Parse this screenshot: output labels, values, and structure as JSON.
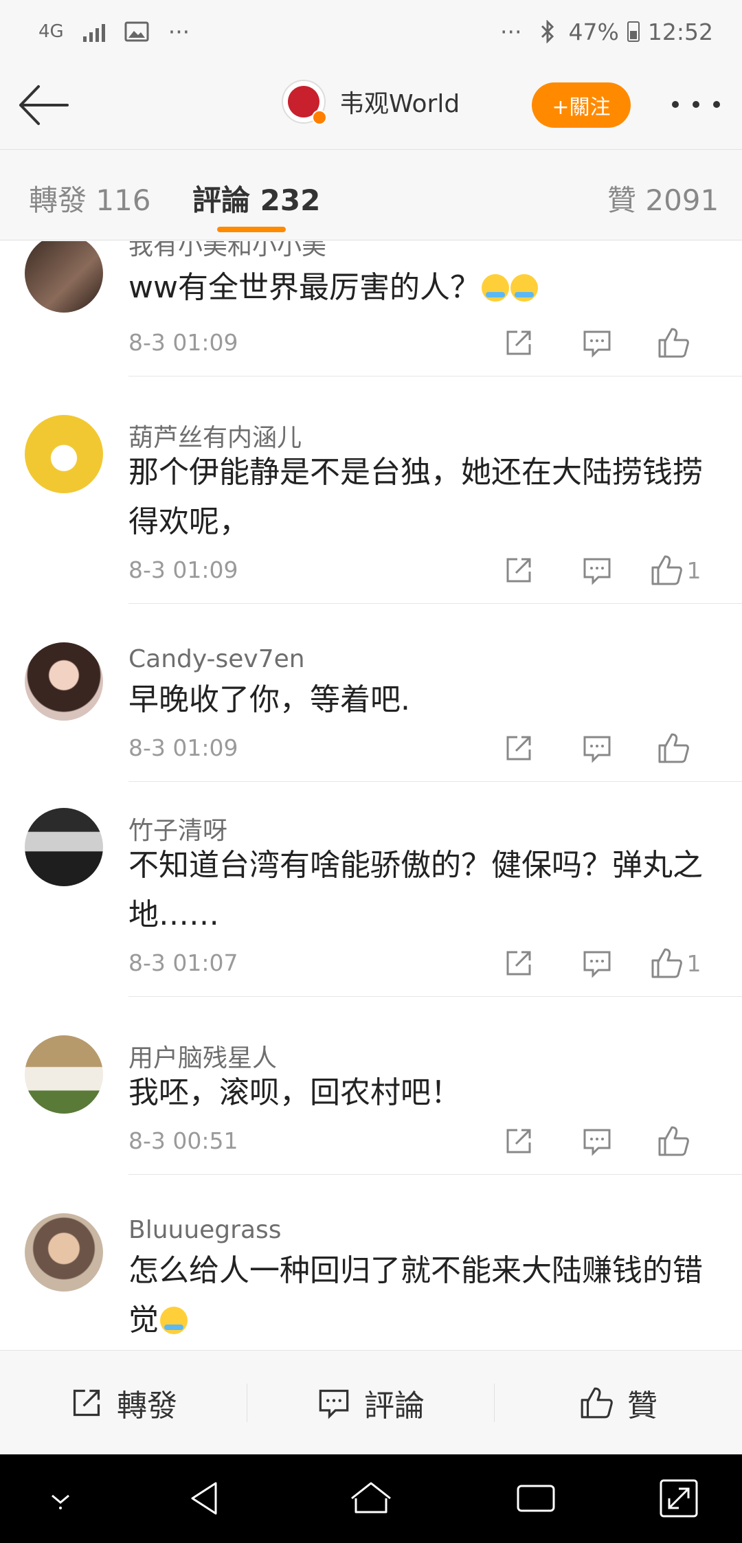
{
  "status_bar": {
    "network": "4G",
    "dots_left": "···",
    "dots_right": "···",
    "battery": "47%",
    "time": "12:52"
  },
  "header": {
    "profile_name": "韦观World",
    "follow_label": "+關注"
  },
  "tabs": [
    {
      "label": "轉發 116"
    },
    {
      "label": "評論 232"
    },
    {
      "label": "贊 2091"
    }
  ],
  "comments": [
    {
      "user": "我有小美和小小美",
      "text": "ww有全世界最厉害的人？",
      "time": "8-3 01:09",
      "likes": ""
    },
    {
      "user": "葫芦丝有内涵儿",
      "text": "那个伊能静是不是台独，她还在大陆捞钱捞得欢呢，",
      "time": "8-3 01:09",
      "likes": "1"
    },
    {
      "user": "Candy-sev7en",
      "text": "早晚收了你，等着吧.",
      "time": "8-3 01:09",
      "likes": ""
    },
    {
      "user": "竹子清呀",
      "text": "不知道台湾有啥能骄傲的？健保吗？弹丸之地……",
      "time": "8-3 01:07",
      "likes": "1"
    },
    {
      "user": "用户脑残星人",
      "text": "我呸，滚呗，回农村吧！",
      "time": "8-3 00:51",
      "likes": ""
    },
    {
      "user": "Bluuuegrass",
      "text": "怎么给人一种回归了就不能来大陆赚钱的错觉",
      "time": "",
      "likes": ""
    }
  ],
  "bottom_bar": {
    "repost_label": "轉發",
    "comment_label": "評論",
    "like_label": "贊"
  },
  "colors": {
    "accent": "#ff8a00",
    "background": "#f7f7f7",
    "text_primary": "#222222",
    "text_secondary": "#9a9a9a"
  }
}
